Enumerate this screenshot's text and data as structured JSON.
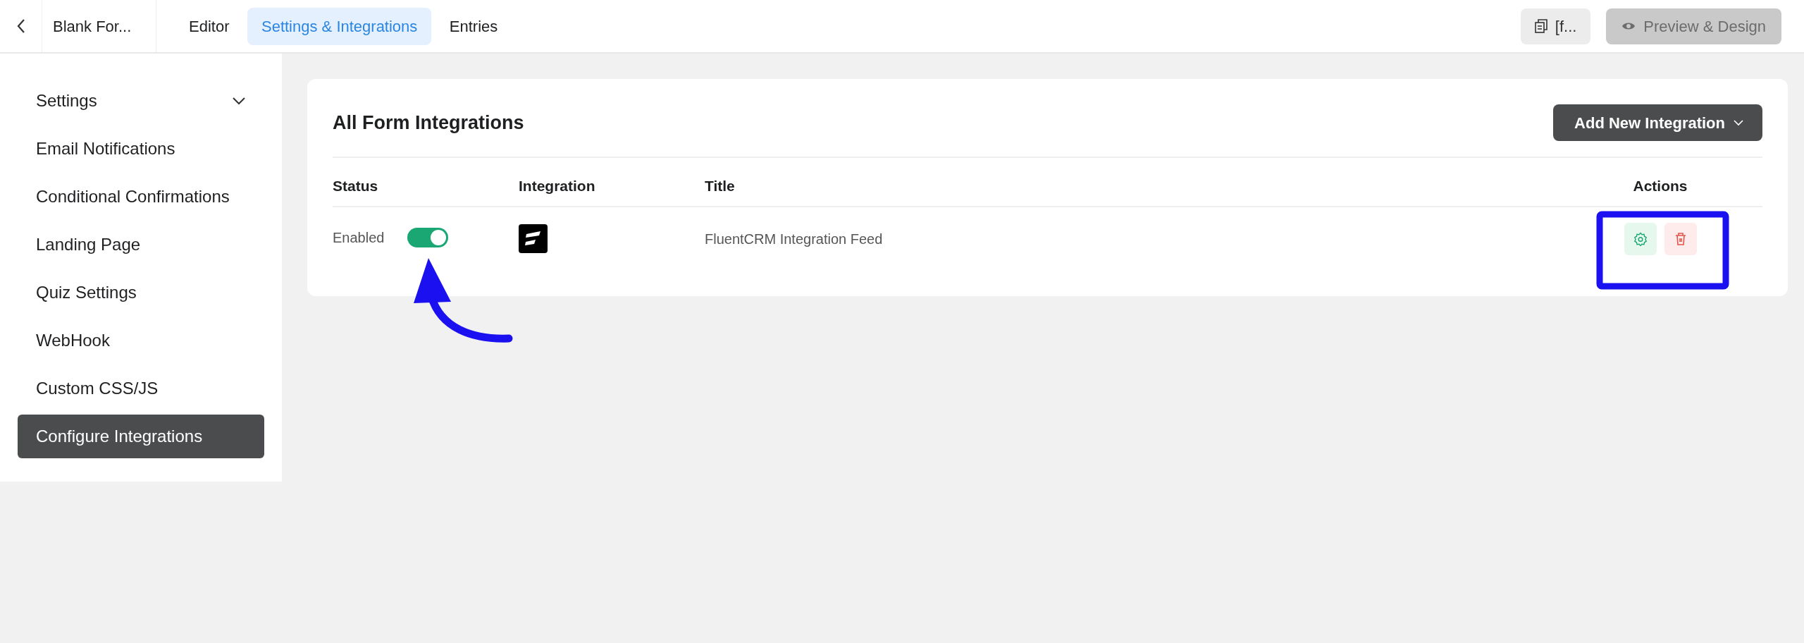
{
  "topbar": {
    "form_name": "Blank For...",
    "tabs": [
      {
        "label": "Editor",
        "selected": false
      },
      {
        "label": "Settings & Integrations",
        "selected": true
      },
      {
        "label": "Entries",
        "selected": false
      }
    ],
    "shortcode_button": "[f...",
    "preview_button": {
      "label": "Preview & Design",
      "disabled": true
    }
  },
  "sidebar": {
    "items": [
      {
        "label": "Settings",
        "kind": "group",
        "selected": false
      },
      {
        "label": "Email Notifications",
        "kind": "link",
        "selected": false
      },
      {
        "label": "Conditional Confirmations",
        "kind": "link",
        "selected": false
      },
      {
        "label": "Landing Page",
        "kind": "link",
        "selected": false
      },
      {
        "label": "Quiz Settings",
        "kind": "link",
        "selected": false
      },
      {
        "label": "WebHook",
        "kind": "link",
        "selected": false
      },
      {
        "label": "Custom CSS/JS",
        "kind": "link",
        "selected": false
      },
      {
        "label": "Configure Integrations",
        "kind": "link",
        "selected": true
      }
    ]
  },
  "panel": {
    "title": "All Form Integrations",
    "add_button": "Add New Integration",
    "columns": [
      "Status",
      "Integration",
      "Title",
      "Actions"
    ],
    "rows": [
      {
        "status": "Enabled",
        "on": true,
        "title": "FluentCRM Integration Feed"
      }
    ]
  }
}
